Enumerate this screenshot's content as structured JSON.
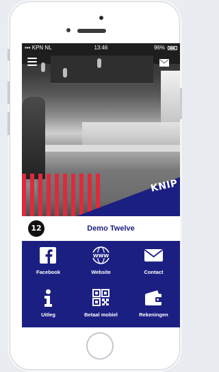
{
  "status_bar": {
    "carrier": "KPN NL",
    "time": "13:46",
    "right_status": "96%"
  },
  "hero": {
    "icons": {
      "menu": "hamburger-menu-icon",
      "mail": "envelope-icon"
    },
    "brand_badge": "KNIP",
    "colors": {
      "stripe_red": "#e0293b",
      "brand_purple": "#1c1f82"
    }
  },
  "company": {
    "logo_text": "12",
    "name": "Demo Twelve"
  },
  "actions": [
    {
      "label": "Facebook",
      "icon": "facebook-icon"
    },
    {
      "label": "Website",
      "icon": "www-globe-icon"
    },
    {
      "label": "Contact",
      "icon": "envelope-icon"
    },
    {
      "label": "Uitleg",
      "icon": "info-icon"
    },
    {
      "label": "Betaal mobiel",
      "icon": "qr-code-icon"
    },
    {
      "label": "Rekeningen",
      "icon": "wallet-icon"
    }
  ]
}
